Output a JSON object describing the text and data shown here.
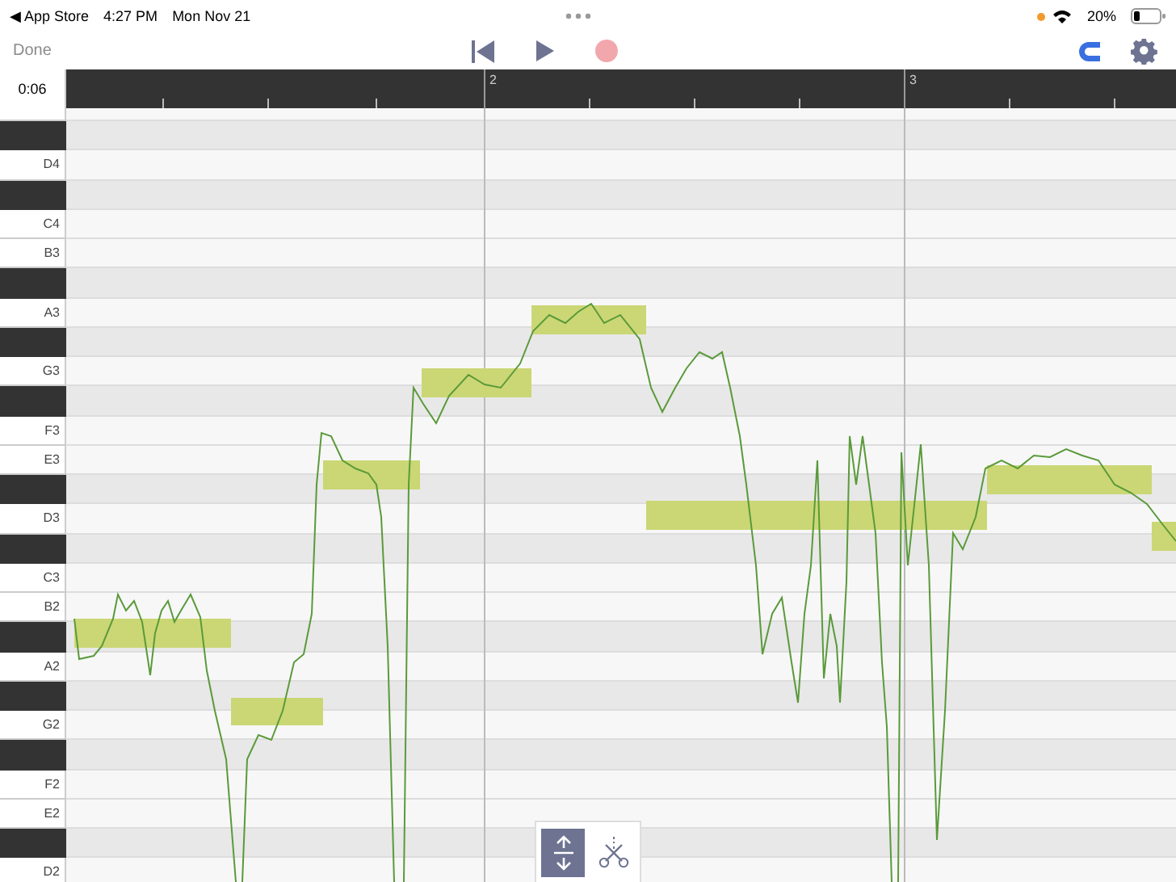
{
  "status_bar": {
    "back_label": "◀ App Store",
    "time": "4:27 PM",
    "date": "Mon Nov 21",
    "battery": "20%"
  },
  "toolbar": {
    "done": "Done"
  },
  "ruler": {
    "time": "0:06",
    "bars": [
      "2",
      "3"
    ]
  },
  "keys": [
    {
      "kind": "white"
    },
    {
      "kind": "black"
    },
    {
      "kind": "white",
      "label": "D4"
    },
    {
      "kind": "black"
    },
    {
      "kind": "white",
      "label": "C4"
    },
    {
      "kind": "white",
      "label": "B3"
    },
    {
      "kind": "black"
    },
    {
      "kind": "white",
      "label": "A3"
    },
    {
      "kind": "black"
    },
    {
      "kind": "white",
      "label": "G3"
    },
    {
      "kind": "black"
    },
    {
      "kind": "white",
      "label": "F3"
    },
    {
      "kind": "white",
      "label": "E3"
    },
    {
      "kind": "black"
    },
    {
      "kind": "white",
      "label": "D3"
    },
    {
      "kind": "black"
    },
    {
      "kind": "white",
      "label": "C3"
    },
    {
      "kind": "white",
      "label": "B2"
    },
    {
      "kind": "black"
    },
    {
      "kind": "white",
      "label": "A2"
    },
    {
      "kind": "black"
    },
    {
      "kind": "white",
      "label": "G2"
    },
    {
      "kind": "black"
    },
    {
      "kind": "white",
      "label": "F2"
    },
    {
      "kind": "white",
      "label": "E2"
    },
    {
      "kind": "black"
    },
    {
      "kind": "white",
      "label": "D2"
    }
  ],
  "tools": [
    {
      "kind": "pitch",
      "selected": true
    },
    {
      "kind": "cut",
      "selected": false
    }
  ]
}
